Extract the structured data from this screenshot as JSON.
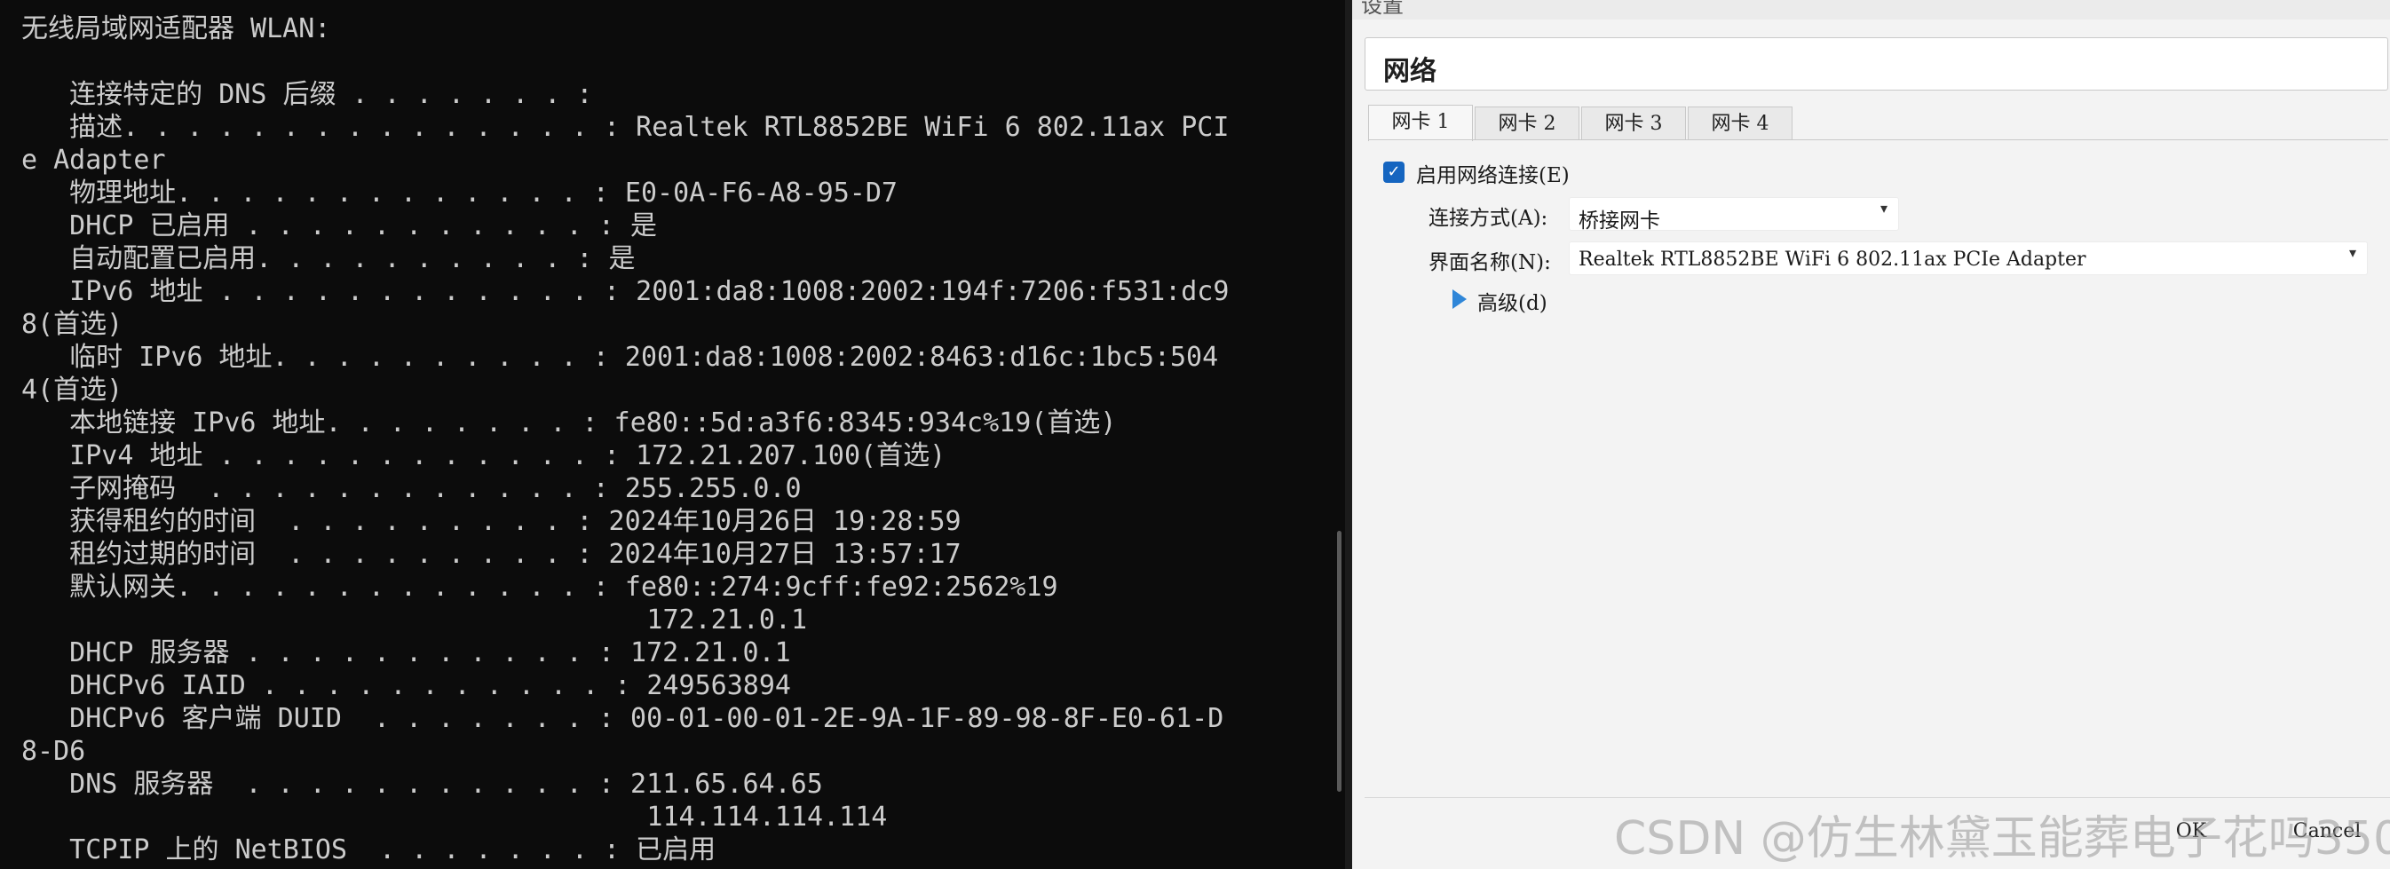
{
  "terminal": {
    "lines": [
      "无线局域网适配器 WLAN:",
      "",
      "   连接特定的 DNS 后缀 . . . . . . . :",
      "   描述. . . . . . . . . . . . . . . : Realtek RTL8852BE WiFi 6 802.11ax PCI",
      "e Adapter",
      "   物理地址. . . . . . . . . . . . . : E0-0A-F6-A8-95-D7",
      "   DHCP 已启用 . . . . . . . . . . . : 是",
      "   自动配置已启用. . . . . . . . . . : 是",
      "   IPv6 地址 . . . . . . . . . . . . : 2001:da8:1008:2002:194f:7206:f531:dc9",
      "8(首选)",
      "   临时 IPv6 地址. . . . . . . . . . : 2001:da8:1008:2002:8463:d16c:1bc5:504",
      "4(首选)",
      "   本地链接 IPv6 地址. . . . . . . . : fe80::5d:a3f6:8345:934c%19(首选)",
      "   IPv4 地址 . . . . . . . . . . . . : 172.21.207.100(首选)",
      "   子网掩码  . . . . . . . . . . . . : 255.255.0.0",
      "   获得租约的时间  . . . . . . . . . : 2024年10月26日 19:28:59",
      "   租约过期的时间  . . . . . . . . . : 2024年10月27日 13:57:17",
      "   默认网关. . . . . . . . . . . . . : fe80::274:9cff:fe92:2562%19",
      "                                       172.21.0.1",
      "   DHCP 服务器 . . . . . . . . . . . : 172.21.0.1",
      "   DHCPv6 IAID . . . . . . . . . . . : 249563894",
      "   DHCPv6 客户端 DUID  . . . . . . . : 00-01-00-01-2E-9A-1F-89-98-8F-E0-61-D",
      "8-D6",
      "   DNS 服务器  . . . . . . . . . . . : 211.65.64.65",
      "                                       114.114.114.114",
      "   TCPIP 上的 NetBIOS  . . . . . . . : 已启用"
    ]
  },
  "dialog": {
    "title": "设置",
    "section_title": "网络",
    "tabs": [
      "网卡 1",
      "网卡 2",
      "网卡 3",
      "网卡 4"
    ],
    "active_tab": 0,
    "enable_label": "启用网络连接(E)",
    "enable_checked": true,
    "attach_label": "连接方式(A):",
    "attach_value": "桥接网卡",
    "iface_label": "界面名称(N):",
    "iface_value": "Realtek RTL8852BE WiFi 6 802.11ax PCIe Adapter",
    "advanced_label": "高级(d)",
    "ok_label": "OK",
    "cancel_label": "Cancel"
  },
  "watermark": "CSDN @仿生林黛玉能葬电子花吗350",
  "colors": {
    "terminal_bg": "#0c0c0c",
    "terminal_text": "#cccccc",
    "dialog_bg": "#f3f3f3",
    "checkbox_accent": "#1565c0",
    "expander_accent": "#2f86d8"
  }
}
